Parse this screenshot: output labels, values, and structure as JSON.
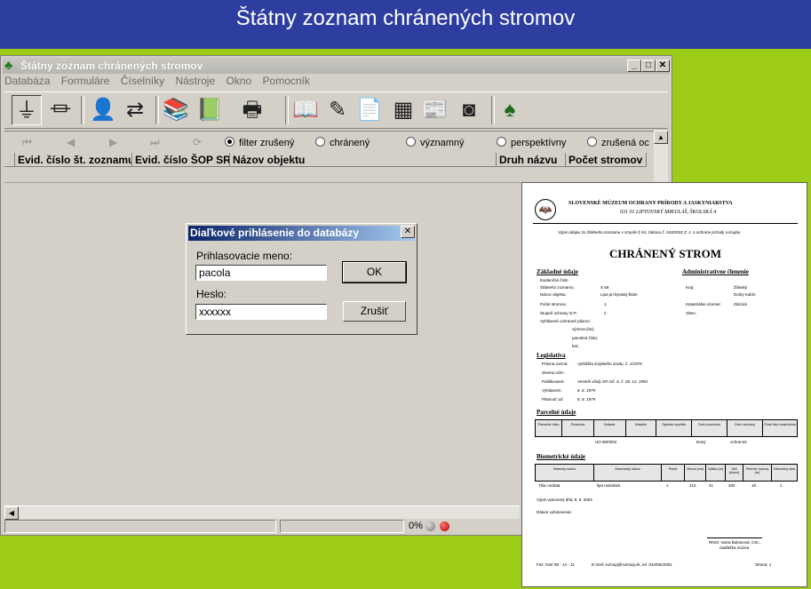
{
  "slide": {
    "title": "Štátny zoznam chránených stromov"
  },
  "colors": {
    "slide_title_bg": "#2e3ea0",
    "slide_bg": "#9ccc17",
    "window_bg": "#d4d0c8",
    "dialog_title": "#0a246a"
  },
  "window": {
    "title": "Štátny zoznam chránených stromov",
    "menu": [
      "Databáza",
      "Formuláre",
      "Číselníky",
      "Nástroje",
      "Okno",
      "Pomocník"
    ],
    "toolbar_icons": [
      "db-connect-icon",
      "db-disconnect-icon",
      "person-icon",
      "refresh-icon",
      "books-icon",
      "book-stack-icon",
      "printer-icon",
      "open-book-icon",
      "write-book-icon",
      "documents-icon",
      "map-icon",
      "newspaper-icon",
      "binoculars-icon",
      "tree-icon"
    ],
    "nav_icons": [
      "first-record-icon",
      "previous-record-icon",
      "next-record-icon",
      "last-record-icon",
      "reload-icon"
    ],
    "filters": [
      {
        "label": "filter zrušený",
        "checked": true
      },
      {
        "label": "chránený",
        "checked": false
      },
      {
        "label": "významný",
        "checked": false
      },
      {
        "label": "perspektívny",
        "checked": false
      },
      {
        "label": "zrušená oc",
        "checked": false
      }
    ],
    "columns": [
      "Evid. číslo št. zoznamu",
      "Evid. číslo ŠOP SR",
      "Názov objektu",
      "Druh názvu",
      "Počet stromov"
    ],
    "status": {
      "percent": "0%"
    }
  },
  "login": {
    "title": "Diaľkové prihlásenie do databázy",
    "username_label": "Prihlasovacie meno:",
    "username_value": "pacola",
    "password_label": "Heslo:",
    "password_value": "xxxxxx",
    "ok_label": "OK",
    "cancel_label": "Zrušiť"
  },
  "report": {
    "org_name": "SLOVENSKÉ MÚZEUM OCHRANY PRÍRODY A JASKYNIARSTVA",
    "org_address": "031 01 LIPTOVSKÝ MIKULÁŠ, ŠKOLSKÁ 4",
    "subtitle": "Výpis údajov zo Štátneho zoznamu v zmysle § 54, zákona č. 543/2002 Z. z. o ochrane prírody a krajiny",
    "heading": "CHRÁNENÝ STROM",
    "sec_basic": "Základné údaje",
    "sec_admin": "Administratívne členenie",
    "basic_rows": [
      {
        "label": "Evidenčné číslo",
        "value": ""
      },
      {
        "label": "Štátneho zoznamu:",
        "value": "S 59"
      },
      {
        "label": "Názov objektu:",
        "value": "Lipa pri bývalej škole"
      },
      {
        "label": "Počet stromov:",
        "value": "1"
      },
      {
        "label": "Stupeň ochrany O.P.:",
        "value": "2"
      },
      {
        "label": "Vyhlásené ochranné pásmo:",
        "value": ""
      }
    ],
    "basic_extra": [
      "výmera (ha):",
      "parcelné čísla:",
      "kat.:"
    ],
    "admin_rows": [
      {
        "label": "Kraj:",
        "value": "Žilinský"
      },
      {
        "label": "",
        "value": "Dolný Kubín"
      },
      {
        "label": "Katastrálne územie:",
        "value": "Zázrivá"
      },
      {
        "label": "Obec:",
        "value": ""
      }
    ],
    "sec_legislation": "Legislatíva",
    "legislation_rows": [
      {
        "label": "Právna norma:",
        "value": "Vyhláška krajského úradu, č. 1/1979"
      },
      {
        "label": "Zmena ochr.:",
        "value": ""
      },
      {
        "label": "Publikované:",
        "value": "Vestník vlády SR roč. 6, č. 28, 12. 1994"
      },
      {
        "label": "Vyhlásené:",
        "value": "8. 8. 1979"
      },
      {
        "label": "Platnosť od:",
        "value": "8. 8. 1979"
      }
    ],
    "sec_parcel": "Parcelné údaje",
    "parcel_headers": [
      "Parcelné číslo",
      "Pozemok",
      "Katastr.",
      "Vlastník",
      "Spôsob využitia",
      "Druh pozemku",
      "Druh ochrany",
      "Číslo listu vlastníctva"
    ],
    "parcel_values": [
      "UO 96/0002",
      "",
      "",
      "",
      "",
      "lesný",
      "ochranné",
      ""
    ],
    "sec_biometric": "Biometrické údaje",
    "bio_headers": [
      "Vedecký názov",
      "Slovenský názov",
      "Počet",
      "Obvod (cm)",
      "Výška (m)",
      "Vek (rokov)",
      "Priemer koruny (m)",
      "Zdravotný stav"
    ],
    "bio_values": [
      "Tilia cordata",
      "lipa malolistá",
      "1",
      "410",
      "21",
      "400",
      "18",
      "1"
    ],
    "date_line": "Výpis vytvorený dňa: 9. 6. 2004",
    "state_label": "Dátum vyhotovenia:",
    "signature": "RNDr. Ivana Bukasová, CSc.",
    "signature_sub": "riaditeľka múzea",
    "footer_left": "Fax: 044/ 55 - 14 - 11",
    "footer_center": "E-mail: sumopj@sumopj.sk, tel. 044/5522061",
    "footer_page": "Strana: 1"
  }
}
